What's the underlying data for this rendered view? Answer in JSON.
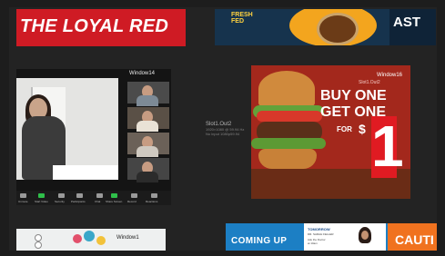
{
  "tiles": {
    "loyal_red": {
      "text": "THE LOYAL RED"
    },
    "food_banner": {
      "vertical_text": "FRESH FED",
      "right_text": "AST"
    },
    "meeting": {
      "title": "Window14",
      "toolbar": [
        "Unmute",
        "Start Video",
        "Security",
        "Participants",
        "Chat",
        "Share Screen",
        "Record",
        "Reactions"
      ]
    },
    "slot_label": {
      "name": "Slot1.Out2",
      "lines": [
        "1920×1080 @ 59.94 Hz",
        "No input 1080p59.94"
      ]
    },
    "burger_ad": {
      "title": "Window16",
      "slot": "Slot1.Out2",
      "line1": "BUY ONE",
      "line2": "GET ONE",
      "for": "FOR",
      "dollar": "$",
      "price": "1"
    },
    "bottom_left": {
      "title": "Window1"
    },
    "bottom_right": {
      "coming_up": "COMING UP",
      "tomorrow": "TOMORROW",
      "doctor": "DR. SARAH FELLER",
      "details": [
        "Ask the Doctor",
        "at 10am"
      ],
      "caution": "CAUTI",
      "slot": "Slot"
    }
  },
  "colors": {
    "background": "#1d1d1d",
    "loyal_red": "#cf1b24",
    "burger_red": "#a3281c",
    "price_red": "#e01b22",
    "coming_up_blue": "#1c7fc4",
    "caution_orange": "#f0721f"
  }
}
